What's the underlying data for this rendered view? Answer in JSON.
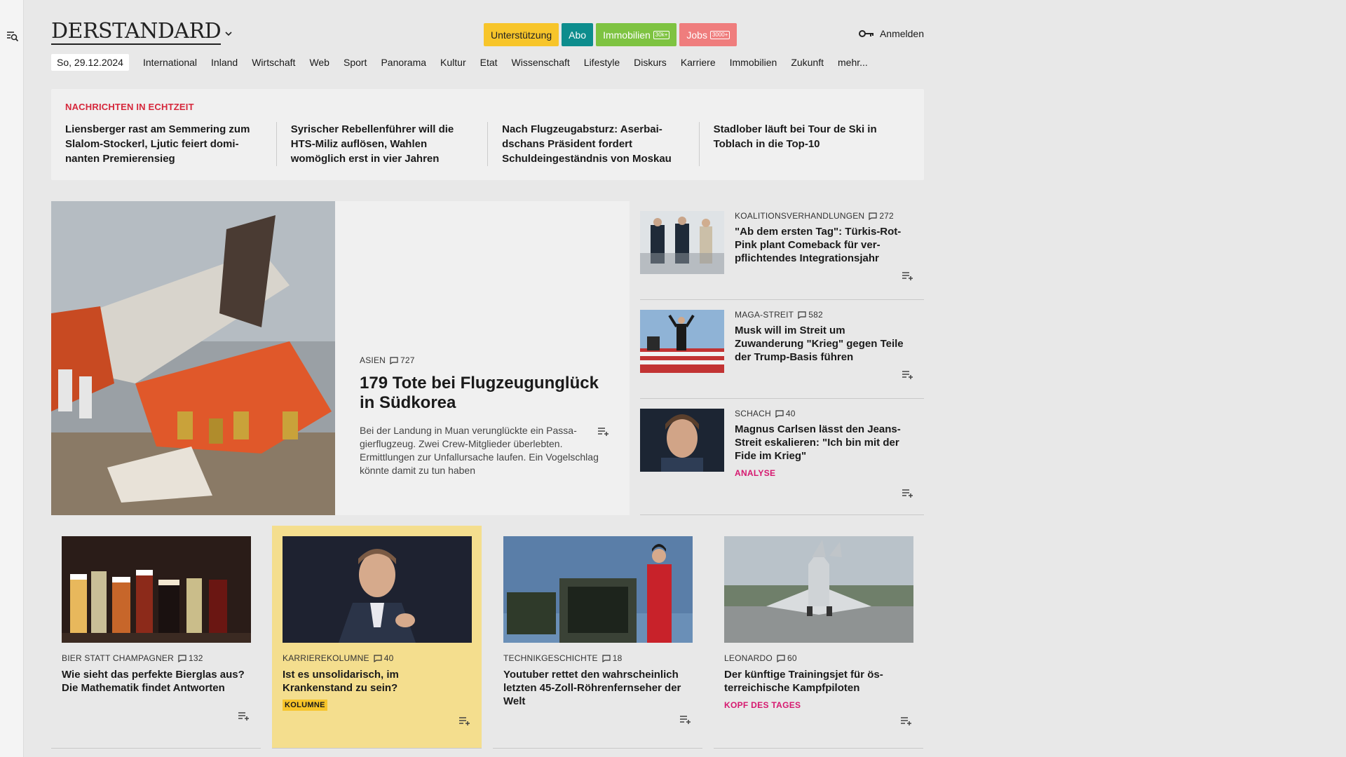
{
  "header": {
    "logo": "DERSTANDARD",
    "pills": [
      {
        "label": "Unterstützung"
      },
      {
        "label": "Abo"
      },
      {
        "label": "Immobilien",
        "badge": "30k+"
      },
      {
        "label": "Jobs",
        "badge": "3000+"
      }
    ],
    "login_label": "Anmelden"
  },
  "nav": {
    "date": "So, 29.12.2024",
    "items": [
      "International",
      "Inland",
      "Wirtschaft",
      "Web",
      "Sport",
      "Panorama",
      "Kultur",
      "Etat",
      "Wissenschaft",
      "Lifestyle",
      "Diskurs",
      "Karriere",
      "Immobilien",
      "Zukunft",
      "mehr..."
    ]
  },
  "ticker": {
    "title": "NACHRICHTEN IN ECHTZEIT",
    "items": [
      "Liensberger rast am Semmering zum Slalom-Stockerl, Ljutic feiert domi­nanten Premierensieg",
      "Syrischer Rebellenführer will die HTS-Miliz auflösen, Wahlen womöglich erst in vier Jahren",
      "Nach Flugzeugabsturz: Aserbai­dschans Präsident fordert Schuldein­geständnis von Moskau",
      "Stadlober läuft bei Tour de Ski in Toblach in die Top-10"
    ]
  },
  "lead": {
    "kicker": "ASIEN",
    "comments": "727",
    "title": "179 Tote bei Flugzeugunglück in Südkorea",
    "teaser": "Bei der Landung in Muan verunglückte ein Passa­gierflugzeug. Zwei Crew-Mitglieder überlebten. Ermittlungen zur Unfallursache laufen. Ein Vogelschlag könnte damit zu tun haben"
  },
  "side": [
    {
      "kicker": "KOALITIONSVERHANDLUNGEN",
      "comments": "272",
      "title": "\"Ab dem ersten Tag\": Türkis-Rot-Pink plant Comeback für ver­pflichtendes Integrationsjahr",
      "label": ""
    },
    {
      "kicker": "MAGA-STREIT",
      "comments": "582",
      "title": "Musk will im Streit um Zuwanderung \"Krieg\" gegen Teile der Trump-Basis führen",
      "label": ""
    },
    {
      "kicker": "SCHACH",
      "comments": "40",
      "title": "Magnus Carlsen lässt den Jeans-Streit eskalieren: \"Ich bin mit der Fide im Krieg\"",
      "label": "ANALYSE"
    }
  ],
  "cards": [
    {
      "kicker": "BIER STATT CHAMPAGNER",
      "comments": "132",
      "title": "Wie sieht das perfekte Bierglas aus? Die Mathematik findet Antworten",
      "label": ""
    },
    {
      "kicker": "KARRIEREKOLUMNE",
      "comments": "40",
      "title": "Ist es unsolidarisch, im Krankenstand zu sein?",
      "label": "KOLUMNE"
    },
    {
      "kicker": "TECHNIKGESCHICHTE",
      "comments": "18",
      "title": "Youtuber rettet den wahrscheinlich letzten 45-Zoll-Röhrenfernseher der Welt",
      "label": ""
    },
    {
      "kicker": "LEONARDO",
      "comments": "60",
      "title": "Der künftige Trainingsjet für ös­terreichische Kampfpiloten",
      "label": "KOPF DES TAGES"
    }
  ],
  "icons": {
    "search": "search-menu-icon",
    "chevron": "chevron-down-icon",
    "key": "key-icon",
    "comment": "comment-icon",
    "addlist": "add-to-list-icon"
  }
}
